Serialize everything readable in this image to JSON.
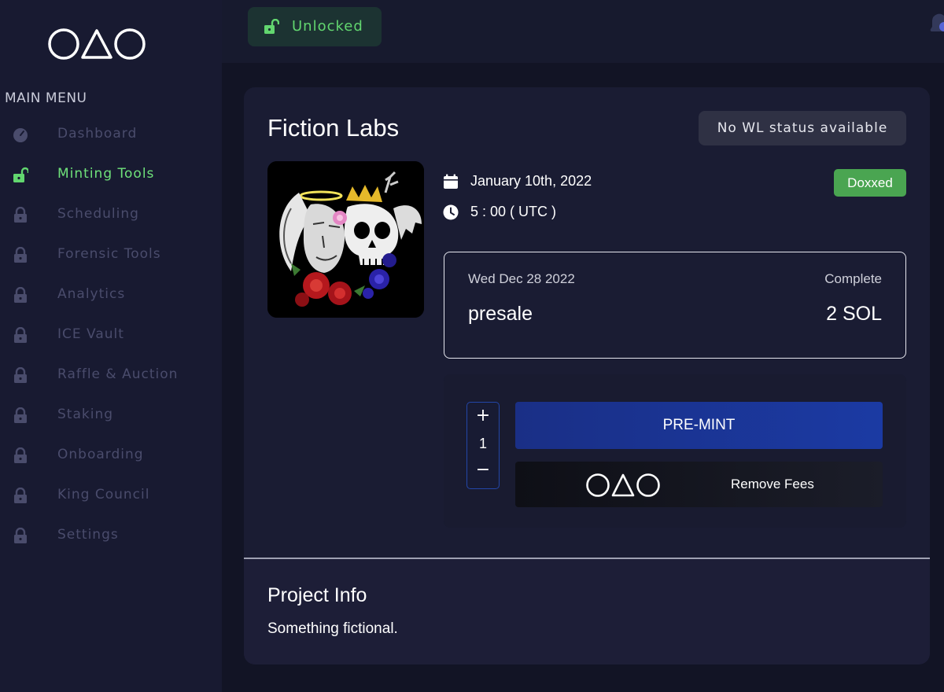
{
  "sidebar": {
    "logo_icon": "circle-triangle-circle-logo",
    "menu_title": "MAIN MENU",
    "items": [
      {
        "label": "Dashboard",
        "icon": "gauge-icon",
        "active": false
      },
      {
        "label": "Minting Tools",
        "icon": "unlocked-icon",
        "active": true
      },
      {
        "label": "Scheduling",
        "icon": "lock-icon",
        "active": false
      },
      {
        "label": "Forensic Tools",
        "icon": "lock-icon",
        "active": false
      },
      {
        "label": "Analytics",
        "icon": "lock-icon",
        "active": false
      },
      {
        "label": "ICE Vault",
        "icon": "lock-icon",
        "active": false
      },
      {
        "label": "Raffle & Auction",
        "icon": "lock-icon",
        "active": false
      },
      {
        "label": "Staking",
        "icon": "lock-icon",
        "active": false
      },
      {
        "label": "Onboarding",
        "icon": "lock-icon",
        "active": false
      },
      {
        "label": "King Council",
        "icon": "lock-icon",
        "active": false
      },
      {
        "label": "Settings",
        "icon": "lock-icon",
        "active": false
      }
    ]
  },
  "topbar": {
    "status_label": "Unlocked",
    "status_icon": "unlocked-icon",
    "notification_icon": "bell-icon"
  },
  "project": {
    "name": "Fiction Labs",
    "wl_status": "No WL status available",
    "date": "January 10th, 2022",
    "time": "5 : 00 ( UTC )",
    "badge": "Doxxed",
    "phase": {
      "date": "Wed Dec 28 2022",
      "status": "Complete",
      "name": "presale",
      "price": "2 SOL"
    },
    "mint": {
      "plus": "+",
      "quantity": "1",
      "minus": "−",
      "premint_label": "PRE-MINT",
      "remove_fees_label": "Remove Fees"
    },
    "info_title": "Project Info",
    "info_text": "Something fictional."
  },
  "colors": {
    "accent_green": "#62d66f",
    "primary_blue": "#1b3aa3",
    "badge_green": "#4aa551",
    "sidebar_bg": "#181a31",
    "page_bg": "#121425"
  }
}
